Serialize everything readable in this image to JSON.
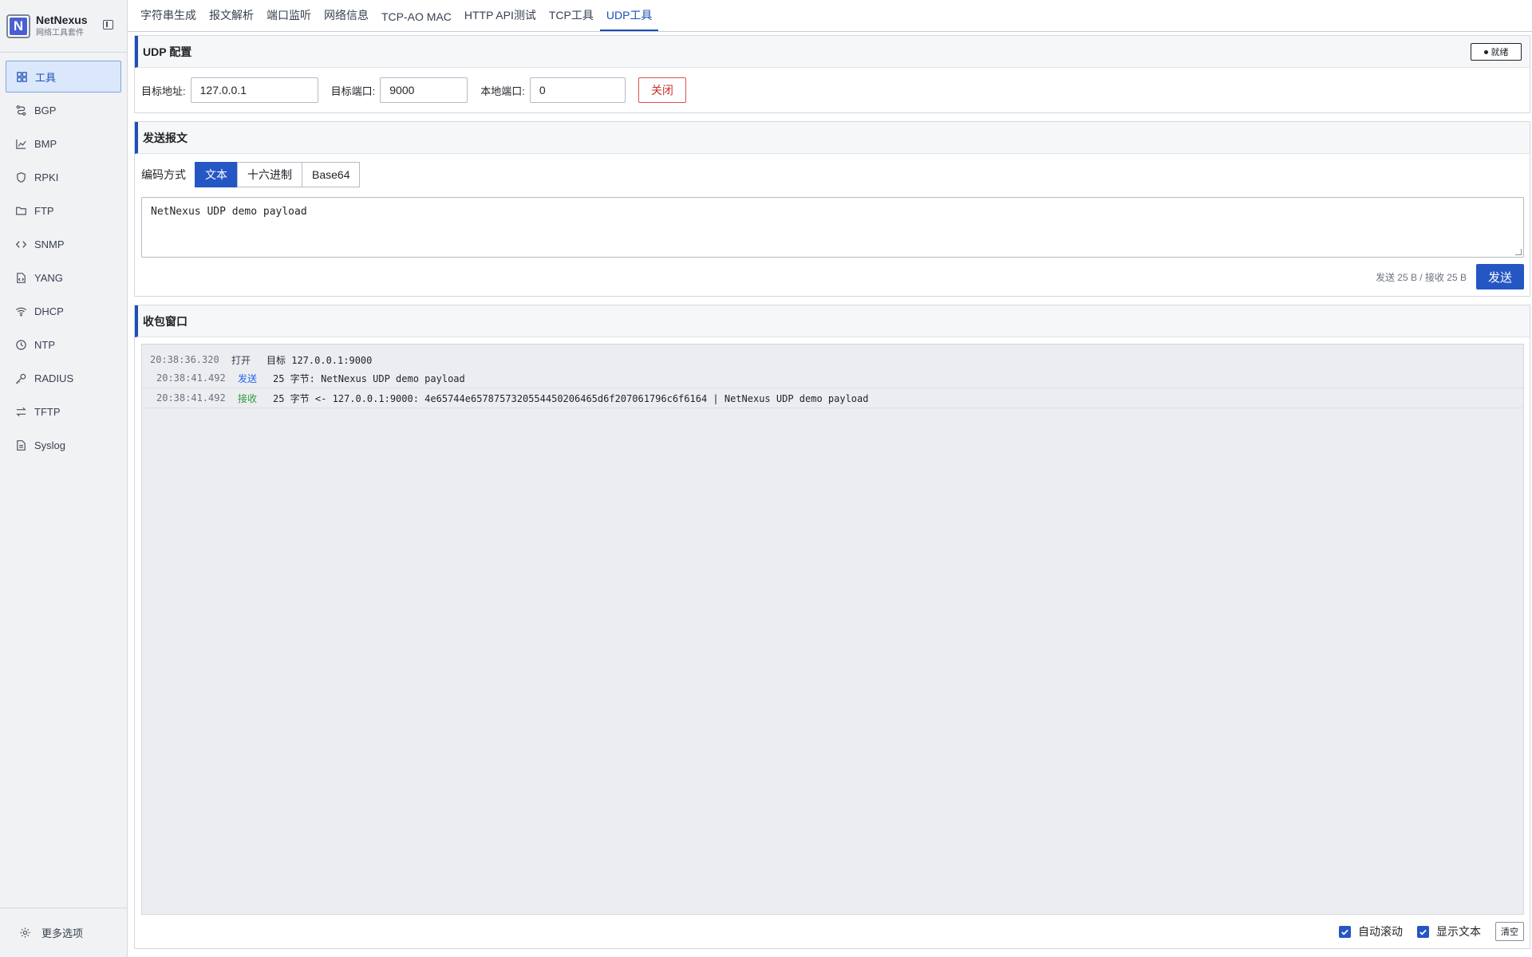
{
  "brand": {
    "name": "NetNexus",
    "subtitle": "网络工具套件",
    "logo_letter": "N"
  },
  "sidebar": {
    "items": [
      {
        "label": "工具",
        "icon": "grid-icon",
        "active": true
      },
      {
        "label": "BGP",
        "icon": "route-icon"
      },
      {
        "label": "BMP",
        "icon": "chart-icon"
      },
      {
        "label": "RPKI",
        "icon": "shield-icon"
      },
      {
        "label": "FTP",
        "icon": "folder-icon"
      },
      {
        "label": "SNMP",
        "icon": "code-icon"
      },
      {
        "label": "YANG",
        "icon": "file-code-icon"
      },
      {
        "label": "DHCP",
        "icon": "wifi-icon"
      },
      {
        "label": "NTP",
        "icon": "clock-icon"
      },
      {
        "label": "RADIUS",
        "icon": "key-icon"
      },
      {
        "label": "TFTP",
        "icon": "transfer-icon"
      },
      {
        "label": "Syslog",
        "icon": "document-icon"
      }
    ],
    "footer_label": "更多选项"
  },
  "tabs": [
    "字符串生成",
    "报文解析",
    "端口监听",
    "网络信息",
    "TCP-AO MAC",
    "HTTP API测试",
    "TCP工具",
    "UDP工具"
  ],
  "active_tab": "UDP工具",
  "udp_config": {
    "title": "UDP 配置",
    "status": "就绪",
    "target_addr_label": "目标地址:",
    "target_addr_value": "127.0.0.1",
    "target_port_label": "目标端口:",
    "target_port_value": "9000",
    "local_port_label": "本地端口:",
    "local_port_value": "0",
    "close_label": "关闭"
  },
  "send": {
    "title": "发送报文",
    "encoding_label": "编码方式",
    "encodings": [
      "文本",
      "十六进制",
      "Base64"
    ],
    "active_encoding": "文本",
    "payload": "NetNexus UDP demo payload",
    "stats": "发送 25 B / 接收 25 B",
    "send_label": "发送"
  },
  "receive": {
    "title": "收包窗口",
    "log": [
      {
        "time": "20:38:36.320",
        "kind": "打开",
        "type": "open",
        "text": "目标 127.0.0.1:9000"
      },
      {
        "time": "20:38:41.492",
        "kind": "发送",
        "type": "send",
        "text": "25 字节: NetNexus UDP demo payload"
      },
      {
        "time": "20:38:41.492",
        "kind": "接收",
        "type": "recv",
        "text": "25 字节 <- 127.0.0.1:9000: 4e65744e6578757320554450206465d6f207061796c6f6164 | NetNexus UDP demo payload"
      }
    ],
    "auto_scroll_label": "自动滚动",
    "show_text_label": "显示文本",
    "clear_label": "清空"
  },
  "colors": {
    "accent": "#2456c4",
    "send": "#2563eb",
    "recv": "#2e9d3a",
    "danger": "#c9302c"
  }
}
